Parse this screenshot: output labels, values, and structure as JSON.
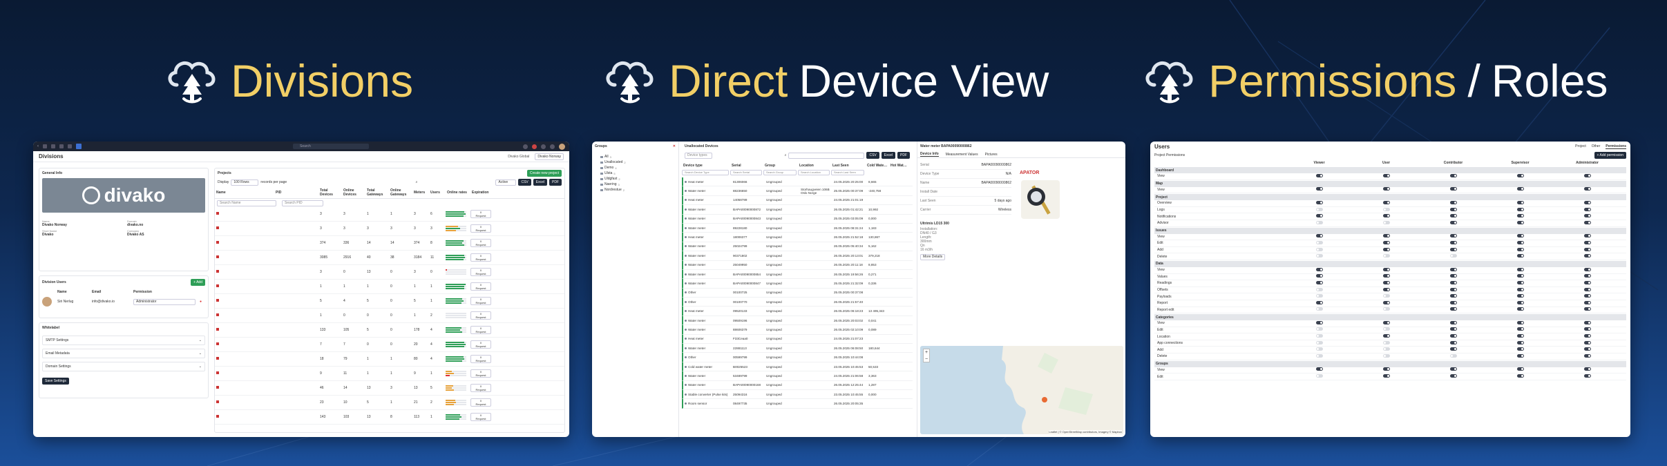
{
  "heroes": [
    {
      "accent": "Divisions",
      "plain": ""
    },
    {
      "accent": "Direct",
      "plain": "Device View"
    },
    {
      "accent": "Permissions",
      "separator": "/",
      "plain": "Roles"
    }
  ],
  "colors": {
    "accent": "#f2cf66",
    "bg_top": "#0a1a33",
    "bg_bottom": "#1b4f9a",
    "green": "#2e9e57"
  },
  "divisions": {
    "search_placeholder": "Search",
    "page_title": "Divisions",
    "chips": [
      "Divako Global",
      "Divako Norway"
    ],
    "general_info_title": "General Info",
    "logo_text": "divako",
    "fields": [
      {
        "label": "Name",
        "value": "Divako Norway"
      },
      {
        "label": "Domain",
        "value": "divako.no"
      },
      {
        "label": "Short Name",
        "value": "Divako"
      },
      {
        "label": "Company",
        "value": "Divako AS"
      }
    ],
    "division_users_title": "Division Users",
    "add_label": "+ Add",
    "users_headers": [
      "Name",
      "Email",
      "Permission"
    ],
    "user": {
      "name": "Siri Nerlug",
      "email": "info@divako.io",
      "permission": "Administrator"
    },
    "whitelabel_title": "Whitelabel",
    "settings_sections": [
      "SMTP Settings",
      "Email Metadata",
      "Domain Settings"
    ],
    "save_label": "Save Settings",
    "projects_title": "Projects",
    "create_label": "Create new project",
    "display_label": "Display",
    "display_value": "100 Rows",
    "records_label": "records per page",
    "active_label": "Active",
    "export_buttons": [
      "CSV",
      "Excel",
      "PDF"
    ],
    "table_headers": [
      "Name",
      "PID",
      "Total Devices",
      "Online Devices",
      "Total Gateways",
      "Online Gateways",
      "Meters",
      "Users",
      "Online rates",
      "Expiration"
    ],
    "name_search": "Search Name",
    "pid_search": "Search PID",
    "request_label": "Request",
    "rows": [
      {
        "total": "3",
        "online": "3",
        "gw": "1",
        "ogw": "1",
        "meters": "3",
        "users": "6",
        "rates": [
          0.9,
          0.95,
          0.85
        ],
        "exp": "0"
      },
      {
        "total": "3",
        "online": "3",
        "gw": "3",
        "ogw": "3",
        "meters": "3",
        "users": "3",
        "rates": [
          0.6,
          0.7,
          0.5
        ],
        "exp": "0"
      },
      {
        "total": "374",
        "online": "336",
        "gw": "14",
        "ogw": "14",
        "meters": "374",
        "users": "8",
        "rates": [
          0.85,
          0.8,
          0.9
        ],
        "exp": "0"
      },
      {
        "total": "3085",
        "online": "2916",
        "gw": "40",
        "ogw": "38",
        "meters": "3184",
        "users": "11",
        "rates": [
          0.9,
          0.92,
          0.88
        ],
        "exp": "0"
      },
      {
        "total": "3",
        "online": "0",
        "gw": "13",
        "ogw": "0",
        "meters": "3",
        "users": "0",
        "rates": [
          0.05,
          0.0,
          0.0
        ],
        "exp": "0"
      },
      {
        "total": "1",
        "online": "1",
        "gw": "1",
        "ogw": "0",
        "meters": "1",
        "users": "1",
        "rates": [
          0.95,
          0.9,
          0.9
        ],
        "exp": "0"
      },
      {
        "total": "5",
        "online": "4",
        "gw": "5",
        "ogw": "0",
        "meters": "5",
        "users": "1",
        "rates": [
          0.8,
          0.85,
          0.75
        ],
        "exp": "0"
      },
      {
        "total": "1",
        "online": "0",
        "gw": "0",
        "ogw": "0",
        "meters": "1",
        "users": "2",
        "rates": [
          0.0,
          0.0,
          0.0
        ],
        "exp": "0"
      },
      {
        "total": "133",
        "online": "105",
        "gw": "5",
        "ogw": "0",
        "meters": "178",
        "users": "4",
        "rates": [
          0.75,
          0.7,
          0.8
        ],
        "exp": "0"
      },
      {
        "total": "7",
        "online": "7",
        "gw": "0",
        "ogw": "0",
        "meters": "20",
        "users": "4",
        "rates": [
          0.9,
          0.95,
          0.9
        ],
        "exp": "0"
      },
      {
        "total": "18",
        "online": "79",
        "gw": "1",
        "ogw": "1",
        "meters": "80",
        "users": "4",
        "rates": [
          0.85,
          0.9,
          0.8
        ],
        "exp": "0"
      },
      {
        "total": "9",
        "online": "11",
        "gw": "1",
        "ogw": "1",
        "meters": "9",
        "users": "1",
        "rates": [
          0.3,
          0.4,
          0.2
        ],
        "exp": "0"
      },
      {
        "total": "46",
        "online": "14",
        "gw": "13",
        "ogw": "3",
        "meters": "13",
        "users": "5",
        "rates": [
          0.35,
          0.3,
          0.4
        ],
        "exp": "0"
      },
      {
        "total": "23",
        "online": "10",
        "gw": "5",
        "ogw": "1",
        "meters": "21",
        "users": "2",
        "rates": [
          0.45,
          0.5,
          0.4
        ],
        "exp": "0"
      },
      {
        "total": "143",
        "online": "103",
        "gw": "13",
        "ogw": "8",
        "meters": "113",
        "users": "1",
        "rates": [
          0.7,
          0.75,
          0.65
        ],
        "exp": "0"
      }
    ]
  },
  "devices": {
    "groups_title": "Groups",
    "tree": [
      {
        "label": "All",
        "count": "3"
      },
      {
        "label": "Unallocated",
        "count": "2"
      },
      {
        "label": "Demo",
        "count": "4"
      },
      {
        "label": "Ulsta",
        "count": "5"
      },
      {
        "label": "Uldgfast",
        "count": "2"
      },
      {
        "label": "Naering",
        "count": "3"
      },
      {
        "label": "Nordrestue",
        "count": "2"
      }
    ],
    "list_title": "Unallocated Devices",
    "device_types_label": "Device types",
    "export_buttons": [
      "CSV",
      "Excel",
      "PDF"
    ],
    "headers": [
      "Device type",
      "Serial",
      "Group",
      "Location",
      "Last Seen",
      "Cold Water (m³)",
      "Hot Water (m³)"
    ],
    "search_placeholders": [
      "Search Device Type",
      "Search Serial",
      "Search Group",
      "Search Location",
      "Search Last Seen"
    ],
    "rows": [
      {
        "type": "Heat meter",
        "serial": "81306066",
        "group": "Ungrouped",
        "location": "",
        "seen": "24.05.2025 20:25:00",
        "value": "8,665"
      },
      {
        "type": "Water meter",
        "serial": "88236650",
        "group": "Ungrouped",
        "location": "Storhaugveien 106B Oslo Norge",
        "seen": "25.05.2025 00:37:09",
        "value": "-240,758"
      },
      {
        "type": "Heat meter",
        "serial": "14058789",
        "group": "Ungrouped",
        "location": "",
        "seen": "24.05.2025 21:01:19",
        "value": ""
      },
      {
        "type": "Water meter",
        "serial": "BAPA00090000872",
        "group": "Ungrouped",
        "location": "",
        "seen": "26.05.2025 01:42:21",
        "value": "10,992"
      },
      {
        "type": "Water meter",
        "serial": "BAPA00090000843",
        "group": "Ungrouped",
        "location": "",
        "seen": "25.05.2025 03:05:09",
        "value": "0,000"
      },
      {
        "type": "Water meter",
        "serial": "89228180",
        "group": "Ungrouped",
        "location": "",
        "seen": "26.05.2025 08:31:24",
        "value": "1,183"
      },
      {
        "type": "Heat meter",
        "serial": "18006377",
        "group": "Ungrouped",
        "location": "",
        "seen": "26.05.2025 21:52:18",
        "value": "130,867"
      },
      {
        "type": "Water meter",
        "serial": "25024799",
        "group": "Ungrouped",
        "location": "",
        "seen": "26.05.2025 05:40:34",
        "value": "5,162"
      },
      {
        "type": "Water meter",
        "serial": "90371802",
        "group": "Ungrouped",
        "location": "",
        "seen": "26.05.2025 20:13:01",
        "value": "379,218"
      },
      {
        "type": "Water meter",
        "serial": "25049950",
        "group": "Ungrouped",
        "location": "",
        "seen": "26.05.2025 20:11:18",
        "value": "8,853"
      },
      {
        "type": "Water meter",
        "serial": "BAPA00090000854",
        "group": "Ungrouped",
        "location": "",
        "seen": "26.05.2025 19:56:26",
        "value": "0,271"
      },
      {
        "type": "Water meter",
        "serial": "BAPA00090000847",
        "group": "Ungrouped",
        "location": "",
        "seen": "25.05.2025 21:32:09",
        "value": "0,336"
      },
      {
        "type": "Other",
        "serial": "00100725",
        "group": "Ungrouped",
        "location": "",
        "seen": "25.05.2025 00:37:08",
        "value": ""
      },
      {
        "type": "Other",
        "serial": "00100770",
        "group": "Ungrouped",
        "location": "",
        "seen": "26.05.2025 21:57:40",
        "value": ""
      },
      {
        "type": "Heat meter",
        "serial": "09520133",
        "group": "Ungrouped",
        "location": "",
        "seen": "26.05.2025 06:18:23",
        "value": "13 495,343"
      },
      {
        "type": "Water meter",
        "serial": "09509196",
        "group": "Ungrouped",
        "location": "",
        "seen": "26.05.2025 20:03:02",
        "value": "0,041"
      },
      {
        "type": "Water meter",
        "serial": "88606379",
        "group": "Ungrouped",
        "location": "",
        "seen": "26.05.2025 02:10:09",
        "value": "0,089"
      },
      {
        "type": "Heat meter",
        "serial": "F33Ceaa0",
        "group": "Ungrouped",
        "location": "",
        "seen": "24.05.2025 21:07:23",
        "value": ""
      },
      {
        "type": "Water meter",
        "serial": "22881113",
        "group": "Ungrouped",
        "location": "",
        "seen": "26.05.2025 06:08:50",
        "value": "180,644"
      },
      {
        "type": "Other",
        "serial": "00599799",
        "group": "Ungrouped",
        "location": "",
        "seen": "26.05.2025 10:44:08",
        "value": ""
      },
      {
        "type": "Cold water meter",
        "serial": "B0025523",
        "group": "Ungrouped",
        "location": "",
        "seen": "23.05.2025 10:45:53",
        "value": "50,533"
      },
      {
        "type": "Water meter",
        "serial": "53489799",
        "group": "Ungrouped",
        "location": "",
        "seen": "24.05.2025 21:06:58",
        "value": "3,363"
      },
      {
        "type": "Water meter",
        "serial": "BAPA00090000168",
        "group": "Ungrouped",
        "location": "",
        "seen": "26.05.2025 12:25:44",
        "value": "1,287"
      },
      {
        "type": "Stable converter (Pulse kits)",
        "serial": "25094316",
        "group": "Ungrouped",
        "location": "",
        "seen": "23.05.2025 10:45:55",
        "value": "0,000"
      },
      {
        "type": "Room sensor",
        "serial": "08497735",
        "group": "Ungrouped",
        "location": "",
        "seen": "26.05.2025 20:05:35",
        "value": ""
      }
    ],
    "detail_title": "Water meter BAPA00090000862",
    "detail_tabs": [
      "Device Info",
      "Measurement Values",
      "Pictures"
    ],
    "detail_fields": [
      {
        "label": "Serial",
        "value": "BAPA00090000862"
      },
      {
        "label": "Device Type",
        "value": "N/A"
      },
      {
        "label": "Name",
        "value": "BAPA00090000862"
      },
      {
        "label": "Install Date",
        "value": ""
      },
      {
        "label": "Last Seen",
        "value": "5 days ago"
      },
      {
        "label": "Carrier",
        "value": "Wireless"
      }
    ],
    "brand": "APATOR",
    "specs_title": "Ultrimis LD15 300",
    "specs": [
      "Installation:",
      "DN40 / G3",
      "Length:",
      "300mm",
      "Qn",
      "16 m3/h"
    ],
    "more_details_label": "More Details",
    "map_credit": "Leaflet | © OpenStreetMap contributors, Imagery © Mapbox"
  },
  "permissions": {
    "title": "Users",
    "top_tabs": [
      "Project",
      "Other",
      "Permissions"
    ],
    "section_label": "Project Permissions",
    "add_label": "+ Add permission",
    "roles": [
      "Viewer",
      "User",
      "Contributor",
      "Supervisor",
      "Administrator"
    ],
    "groups": [
      {
        "name": "Dashboard",
        "items": [
          {
            "label": "View",
            "values": [
              1,
              1,
              1,
              1,
              1
            ]
          }
        ]
      },
      {
        "name": "Map",
        "items": [
          {
            "label": "View",
            "values": [
              1,
              1,
              1,
              1,
              1
            ]
          }
        ]
      },
      {
        "name": "Project",
        "items": [
          {
            "label": "Overview",
            "values": [
              1,
              1,
              1,
              1,
              1
            ]
          },
          {
            "label": "Logs",
            "values": [
              0,
              0,
              1,
              1,
              1
            ]
          },
          {
            "label": "Notifications",
            "values": [
              1,
              1,
              1,
              1,
              1
            ]
          },
          {
            "label": "Advisor",
            "values": [
              0,
              0,
              1,
              1,
              1
            ]
          }
        ]
      },
      {
        "name": "Issues",
        "items": [
          {
            "label": "View",
            "values": [
              1,
              1,
              1,
              1,
              1
            ]
          },
          {
            "label": "Edit",
            "values": [
              0,
              1,
              1,
              1,
              1
            ]
          },
          {
            "label": "Add",
            "values": [
              0,
              1,
              1,
              1,
              1
            ]
          },
          {
            "label": "Delete",
            "values": [
              0,
              0,
              0,
              1,
              1
            ]
          }
        ]
      },
      {
        "name": "Data",
        "items": [
          {
            "label": "View",
            "values": [
              1,
              1,
              1,
              1,
              1
            ]
          },
          {
            "label": "Values",
            "values": [
              1,
              1,
              1,
              1,
              1
            ]
          },
          {
            "label": "Readings",
            "values": [
              1,
              1,
              1,
              1,
              1
            ]
          },
          {
            "label": "Offsets",
            "values": [
              0,
              1,
              1,
              1,
              1
            ]
          },
          {
            "label": "Payloads",
            "values": [
              0,
              0,
              1,
              1,
              1
            ]
          },
          {
            "label": "Report",
            "values": [
              1,
              1,
              1,
              1,
              1
            ]
          },
          {
            "label": "Report edit",
            "values": [
              0,
              0,
              1,
              1,
              1
            ]
          }
        ]
      },
      {
        "name": "Categories",
        "items": [
          {
            "label": "View",
            "values": [
              1,
              1,
              1,
              1,
              1
            ]
          },
          {
            "label": "Edit",
            "values": [
              0,
              0,
              1,
              1,
              1
            ]
          },
          {
            "label": "Location",
            "values": [
              0,
              1,
              1,
              1,
              1
            ]
          },
          {
            "label": "App connections",
            "values": [
              0,
              0,
              1,
              1,
              1
            ]
          },
          {
            "label": "Add",
            "values": [
              0,
              0,
              1,
              1,
              1
            ]
          },
          {
            "label": "Delete",
            "values": [
              0,
              0,
              0,
              1,
              1
            ]
          }
        ]
      },
      {
        "name": "Groups",
        "items": [
          {
            "label": "View",
            "values": [
              1,
              1,
              1,
              1,
              1
            ]
          },
          {
            "label": "Edit",
            "values": [
              0,
              1,
              1,
              1,
              1
            ]
          }
        ]
      }
    ]
  }
}
